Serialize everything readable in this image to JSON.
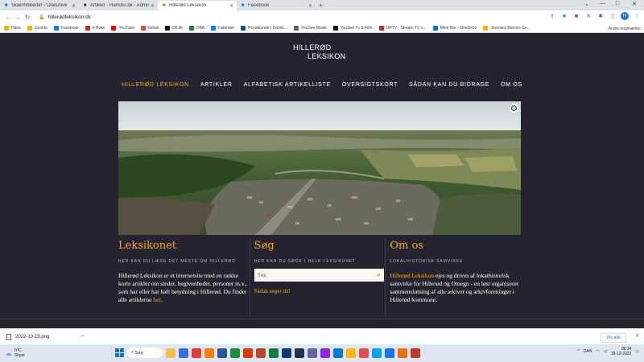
{
  "browser": {
    "tabs": [
      {
        "title": "Skærmbilleder - OneDrive",
        "icon": "onedrive-icon",
        "color": "#0078d4",
        "active": false
      },
      {
        "title": "Artikler - Hansbo.dk - Administra",
        "icon": "joomla-icon",
        "color": "#333333",
        "active": false
      },
      {
        "title": "Hillerød Leksikon",
        "icon": "site-icon",
        "color": "#e8710a",
        "active": true
      },
      {
        "title": "Facebook",
        "icon": "facebook-icon",
        "color": "#1877f2",
        "active": false
      }
    ],
    "url": "hillerødleksikon.dk",
    "avatar_letter": "H",
    "bookmarks": [
      {
        "label": "Hans",
        "color": "#f2b600"
      },
      {
        "label": "Joomla",
        "color": "#f2b600"
      },
      {
        "label": "Facebook",
        "color": "#1877f2"
      },
      {
        "label": "e-Boks",
        "color": "#c62828"
      },
      {
        "label": "YouTube",
        "color": "#ff0000"
      },
      {
        "label": "Gmail",
        "color": "#ea4335"
      },
      {
        "label": "Dfi.dk",
        "color": "#111111"
      },
      {
        "label": "DBA",
        "color": "#2e7d32"
      },
      {
        "label": "Kalender",
        "color": "#1a73e8"
      },
      {
        "label": "Privatkunde | Dansk...",
        "color": "#0b4f8a"
      },
      {
        "label": "YouSee Musik",
        "color": "#5f6368"
      },
      {
        "label": "YouSee Tv & Film",
        "color": "#111111"
      },
      {
        "label": "DRTV - Stream TV o...",
        "color": "#c62828"
      },
      {
        "label": "Mine filer - OneDrive",
        "color": "#0078d4"
      },
      {
        "label": "Joomla's Banner Co...",
        "color": "#f2b600"
      }
    ],
    "bookmarks_other": "Andre bogmærker"
  },
  "site": {
    "logo_line1": "HILLERØD",
    "logo_line2": "LEKSIKON",
    "nav": [
      {
        "label": "HILLERØD LEKSIKON",
        "active": true
      },
      {
        "label": "ARTIKLER",
        "active": false
      },
      {
        "label": "ALFABETISK ARTIKELLISTE",
        "active": false
      },
      {
        "label": "OVERSIGTSKORT",
        "active": false
      },
      {
        "label": "SÅDAN KAN DU BIDRAGE",
        "active": false
      },
      {
        "label": "OM OS",
        "active": false
      }
    ],
    "col1": {
      "title": "Leksikonet",
      "subtitle": "HER KAN DU LÆSE DET MESTE OM HILLERØD",
      "text": "Hillerød Leksikon er et internetsite med en række korte artikler om steder, begivenheder, personer m.v., som har eller har haft betydning i Hillerød. Du finder alle artiklerne ",
      "link": "her."
    },
    "col2": {
      "title": "Søg",
      "subtitle": "HER KAN DU SØGE I HELE LEKSIKONET",
      "search_placeholder": "Søg",
      "link": "Sådan søger du!"
    },
    "col3": {
      "title": "Om os",
      "subtitle": "LOKALHISTORISK SAMVIRKE",
      "highlight": "Hillerød Leksikon",
      "text": " ejes og drives af lokalhistorisk samvirke for Hillerød og Omegn - en løst organiseret sammenslutning af alle arkiver og arkivforeninger i Hillerød kommune."
    }
  },
  "download": {
    "file": "2022-10-19.png",
    "show_all": "Vis alle"
  },
  "taskbar": {
    "temp": "0°C",
    "weather": "Skyet",
    "search": "Søg",
    "lang": "DAN",
    "time": "08:34",
    "date": "18-12-2022",
    "apps": [
      "#f2c14e",
      "#3c6fd8",
      "#e53935",
      "#ff7f00",
      "#2b579a",
      "#1e8e3e",
      "#d83b01",
      "#b7472a",
      "#107c41",
      "#0f3c6e",
      "#26324d",
      "#6264a7",
      "#8a2be2",
      "#0078d4",
      "#ffb900",
      "#e74856",
      "#00a4ef",
      "#1a73e8",
      "#e8710a",
      "#c0392b"
    ]
  }
}
